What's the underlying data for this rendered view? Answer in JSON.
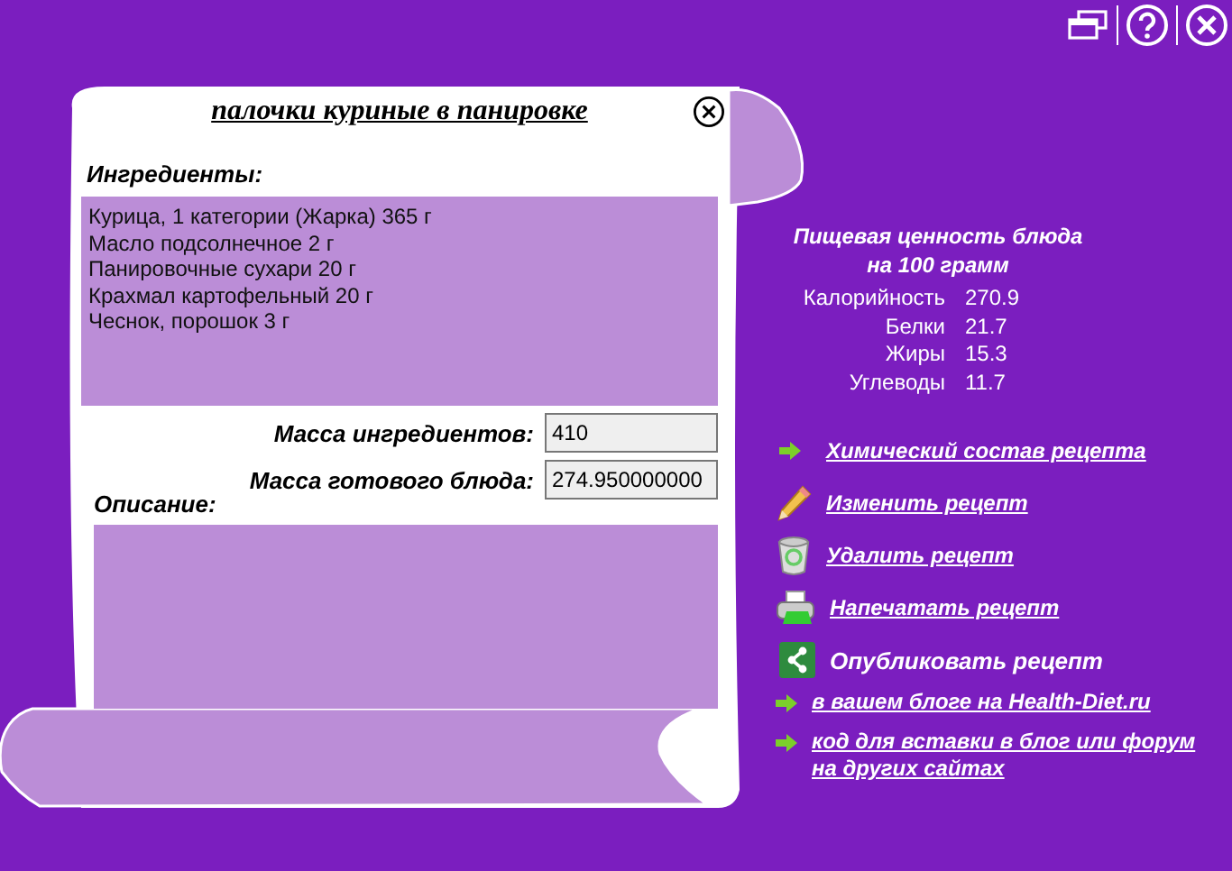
{
  "recipe": {
    "title": "палочки куриные в панировке",
    "ingredients_label": "Ингредиенты:",
    "ingredients": [
      "Курица, 1 категории (Жарка) 365 г",
      "Масло подсолнечное 2 г",
      "Панировочные сухари 20 г",
      "Крахмал картофельный 20 г",
      "Чеснок, порошок 3 г"
    ],
    "mass_fields": [
      {
        "label": "Масса ингредиентов:",
        "value": "410"
      },
      {
        "label": "Масса готового блюда:",
        "value": "274.950000000"
      }
    ],
    "description_label": "Описание:"
  },
  "nutrition": {
    "heading_lines": [
      "Пищевая ценность блюда",
      "на 100 грамм"
    ],
    "rows": [
      {
        "name": "Калорийность",
        "value": "270.9"
      },
      {
        "name": "Белки",
        "value": "21.7"
      },
      {
        "name": "Жиры",
        "value": "15.3"
      },
      {
        "name": "Углеводы",
        "value": "11.7"
      }
    ]
  },
  "actions": [
    {
      "kind": "arrow",
      "label": "Химический состав рецепта",
      "link": true
    },
    {
      "kind": "pencil",
      "label": "Изменить рецепт",
      "link": true
    },
    {
      "kind": "trash",
      "label": "Удалить рецепт",
      "link": true
    },
    {
      "kind": "printer",
      "label": "Напечатать рецепт",
      "link": true
    },
    {
      "kind": "share",
      "label": "Опубликовать рецепт",
      "link": false
    }
  ],
  "publish_links": [
    {
      "label": "в вашем блоге на Health-Diet.ru"
    },
    {
      "label": "код для вставки в блог или форум на других сайтах"
    }
  ]
}
